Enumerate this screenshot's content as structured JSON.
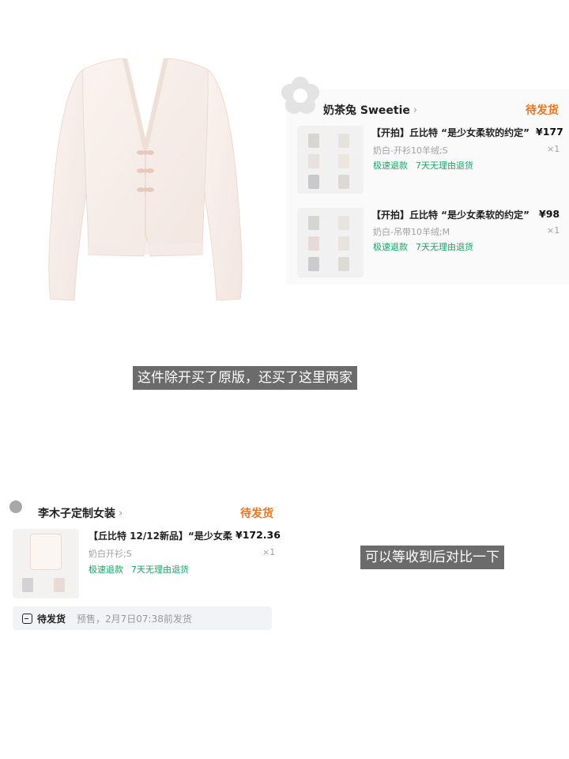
{
  "product_photo": {
    "description_icon": "cardigan-photo"
  },
  "order1": {
    "shop_name": "奶茶兔 Sweetie",
    "chevron": "›",
    "status": "待发货",
    "items": [
      {
        "title": "【开拍】丘比特 “是少女柔软的约定”",
        "price": "¥177",
        "spec": "奶白-开衫10羊绒;S",
        "qty": "×1",
        "tags": [
          "极速退款",
          "7天无理由退货"
        ]
      },
      {
        "title": "【开拍】丘比特 “是少女柔软的约定”",
        "price": "¥98",
        "spec": "奶白-吊带10羊绒;M",
        "qty": "×1",
        "tags": [
          "极速退款",
          "7天无理由退货"
        ]
      }
    ]
  },
  "caption1": "这件除开买了原版，还买了这里两家",
  "caption2": "可以等收到后对比一下",
  "order2": {
    "shop_name": "李木子定制女装",
    "chevron": "›",
    "status": "待发货",
    "item": {
      "title": "【丘比特 12/12新品】“是少女柔",
      "price": "¥172.36",
      "spec": "奶白开衫;S",
      "qty": "×1",
      "tags": [
        "极速退款",
        "7天无理由退货"
      ]
    },
    "bar": {
      "label": "待发货",
      "note": "预售，2月7日07:38前发货"
    }
  },
  "colors": {
    "status_orange": "#f0731c",
    "tag_green": "#17a864",
    "caption_bg": "#6b6b6b"
  }
}
